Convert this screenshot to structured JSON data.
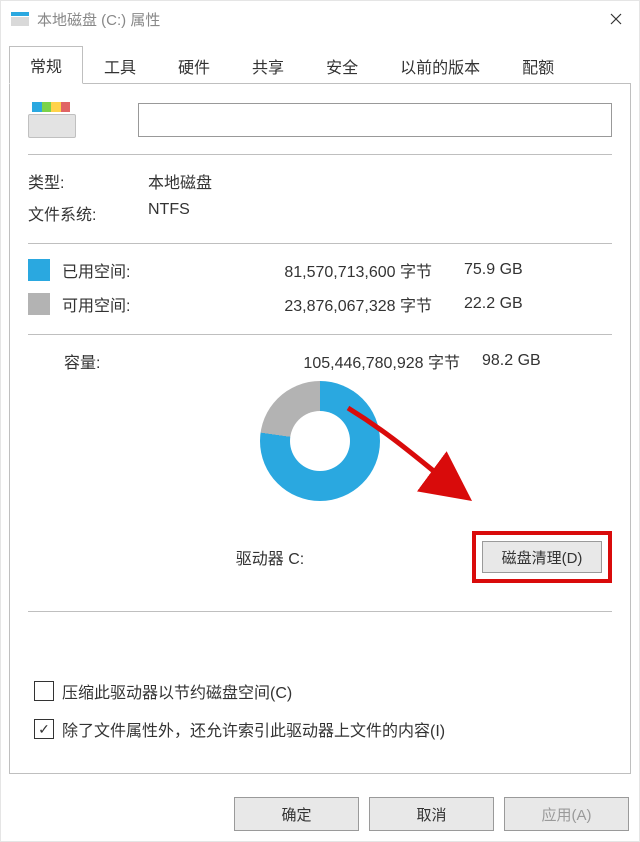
{
  "window": {
    "title": "本地磁盘 (C:) 属性"
  },
  "tabs": [
    "常规",
    "工具",
    "硬件",
    "共享",
    "安全",
    "以前的版本",
    "配额"
  ],
  "activeTab": 0,
  "general": {
    "name_value": "",
    "type_label": "类型:",
    "type_value": "本地磁盘",
    "fs_label": "文件系统:",
    "fs_value": "NTFS",
    "used_label": "已用空间:",
    "used_bytes": "81,570,713,600 字节",
    "used_gb": "75.9 GB",
    "free_label": "可用空间:",
    "free_bytes": "23,876,067,328 字节",
    "free_gb": "22.2 GB",
    "cap_label": "容量:",
    "cap_bytes": "105,446,780,928 字节",
    "cap_gb": "98.2 GB",
    "drive_letter": "驱动器 C:",
    "cleanup_button": "磁盘清理(D)"
  },
  "checks": {
    "compress": {
      "text": "压缩此驱动器以节约磁盘空间(C)",
      "checked": false
    },
    "index": {
      "text": "除了文件属性外，还允许索引此驱动器上文件的内容(I)",
      "checked": true
    }
  },
  "footer": {
    "ok": "确定",
    "cancel": "取消",
    "apply": "应用(A)"
  },
  "chart_data": {
    "type": "pie",
    "title": "驱动器 C:",
    "series": [
      {
        "name": "已用空间",
        "value": 75.9,
        "unit": "GB",
        "color": "#2aa8e0"
      },
      {
        "name": "可用空间",
        "value": 22.2,
        "unit": "GB",
        "color": "#b3b3b3"
      }
    ],
    "total": 98.2
  }
}
